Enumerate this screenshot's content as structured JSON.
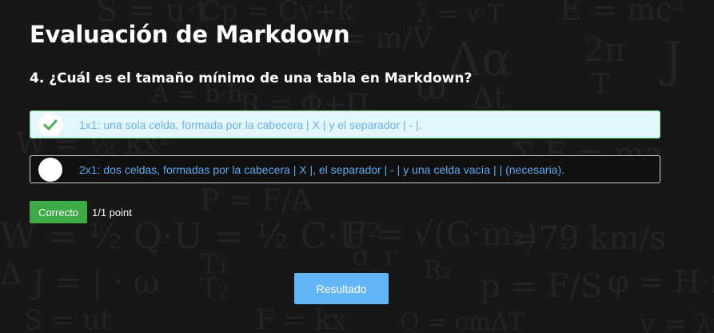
{
  "page": {
    "title": "Evaluación de Markdown"
  },
  "question": {
    "text": "4. ¿Cuál es el tamaño mínimo de una tabla en Markdown?"
  },
  "options": [
    {
      "label": "1x1: una sola celda, formada por la cabecera | X | y el separador | - |.",
      "selected": true,
      "icon": "check-icon"
    },
    {
      "label": "2x1: dos celdas, formadas por la cabecera | X |, el separador | - | y una celda vacía | | (necesaria).",
      "selected": false,
      "icon": "empty-radio-icon"
    }
  ],
  "feedback": {
    "badge": "Correcto",
    "points": "1/1 point"
  },
  "actions": {
    "result_label": "Resultado"
  },
  "colors": {
    "background": "#171717",
    "selected_option_bg": "#e3f6fd",
    "selected_option_border": "#7ee08b",
    "option_text": "#6cb2ef",
    "check": "#4caf50",
    "badge": "#3eaa46",
    "button": "#62b6f6"
  }
}
